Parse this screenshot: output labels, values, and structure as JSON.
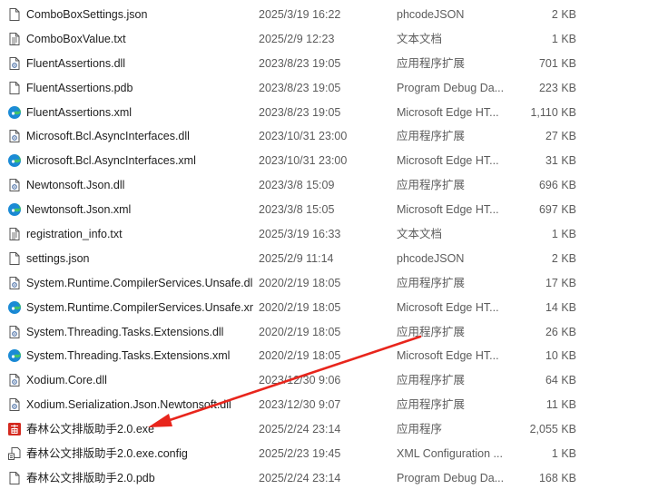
{
  "files": [
    {
      "name": "ComboBoxSettings.json",
      "date": "2025/3/19 16:22",
      "type": "phcodeJSON",
      "size": "2 KB",
      "icon": "blank-file-icon"
    },
    {
      "name": "ComboBoxValue.txt",
      "date": "2025/2/9 12:23",
      "type": "文本文档",
      "size": "1 KB",
      "icon": "text-file-icon"
    },
    {
      "name": "FluentAssertions.dll",
      "date": "2023/8/23 19:05",
      "type": "应用程序扩展",
      "size": "701 KB",
      "icon": "dll-file-icon"
    },
    {
      "name": "FluentAssertions.pdb",
      "date": "2023/8/23 19:05",
      "type": "Program Debug Da...",
      "size": "223 KB",
      "icon": "blank-file-icon"
    },
    {
      "name": "FluentAssertions.xml",
      "date": "2023/8/23 19:05",
      "type": "Microsoft Edge HT...",
      "size": "1,110 KB",
      "icon": "edge-icon"
    },
    {
      "name": "Microsoft.Bcl.AsyncInterfaces.dll",
      "date": "2023/10/31 23:00",
      "type": "应用程序扩展",
      "size": "27 KB",
      "icon": "dll-file-icon"
    },
    {
      "name": "Microsoft.Bcl.AsyncInterfaces.xml",
      "date": "2023/10/31 23:00",
      "type": "Microsoft Edge HT...",
      "size": "31 KB",
      "icon": "edge-icon"
    },
    {
      "name": "Newtonsoft.Json.dll",
      "date": "2023/3/8 15:09",
      "type": "应用程序扩展",
      "size": "696 KB",
      "icon": "dll-file-icon"
    },
    {
      "name": "Newtonsoft.Json.xml",
      "date": "2023/3/8 15:05",
      "type": "Microsoft Edge HT...",
      "size": "697 KB",
      "icon": "edge-icon"
    },
    {
      "name": "registration_info.txt",
      "date": "2025/3/19 16:33",
      "type": "文本文档",
      "size": "1 KB",
      "icon": "text-file-icon"
    },
    {
      "name": "settings.json",
      "date": "2025/2/9 11:14",
      "type": "phcodeJSON",
      "size": "2 KB",
      "icon": "blank-file-icon"
    },
    {
      "name": "System.Runtime.CompilerServices.Unsafe.dll",
      "date": "2020/2/19 18:05",
      "type": "应用程序扩展",
      "size": "17 KB",
      "icon": "dll-file-icon"
    },
    {
      "name": "System.Runtime.CompilerServices.Unsafe.xml",
      "date": "2020/2/19 18:05",
      "type": "Microsoft Edge HT...",
      "size": "14 KB",
      "icon": "edge-icon"
    },
    {
      "name": "System.Threading.Tasks.Extensions.dll",
      "date": "2020/2/19 18:05",
      "type": "应用程序扩展",
      "size": "26 KB",
      "icon": "dll-file-icon"
    },
    {
      "name": "System.Threading.Tasks.Extensions.xml",
      "date": "2020/2/19 18:05",
      "type": "Microsoft Edge HT...",
      "size": "10 KB",
      "icon": "edge-icon"
    },
    {
      "name": "Xodium.Core.dll",
      "date": "2023/12/30 9:06",
      "type": "应用程序扩展",
      "size": "64 KB",
      "icon": "dll-file-icon"
    },
    {
      "name": "Xodium.Serialization.Json.Newtonsoft.dll",
      "date": "2023/12/30 9:07",
      "type": "应用程序扩展",
      "size": "11 KB",
      "icon": "dll-file-icon"
    },
    {
      "name": "春林公文排版助手2.0.exe",
      "date": "2025/2/24 23:14",
      "type": "应用程序",
      "size": "2,055 KB",
      "icon": "app-exe-icon"
    },
    {
      "name": "春林公文排版助手2.0.exe.config",
      "date": "2025/2/23 19:45",
      "type": "XML Configuration ...",
      "size": "1 KB",
      "icon": "config-file-icon"
    },
    {
      "name": "春林公文排版助手2.0.pdb",
      "date": "2025/2/24 23:14",
      "type": "Program Debug Da...",
      "size": "168 KB",
      "icon": "blank-file-icon"
    }
  ],
  "annotation": {
    "arrow_color": "#e8251c"
  }
}
